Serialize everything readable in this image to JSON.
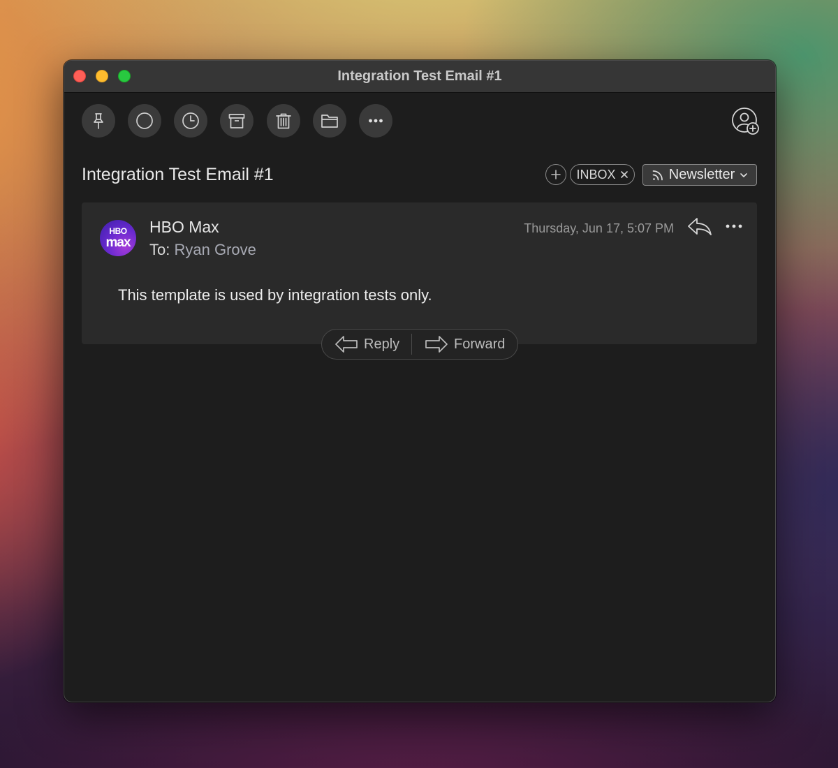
{
  "window": {
    "title": "Integration Test Email #1"
  },
  "toolbar": {
    "buttons": [
      {
        "icon": "pin-icon"
      },
      {
        "icon": "circle-icon"
      },
      {
        "icon": "clock-icon"
      },
      {
        "icon": "archive-icon"
      },
      {
        "icon": "trash-icon"
      },
      {
        "icon": "folder-icon"
      },
      {
        "icon": "more-icon"
      }
    ],
    "account_icon": "add-account-icon"
  },
  "header": {
    "subject": "Integration Test Email #1",
    "label": "INBOX",
    "category": "Newsletter"
  },
  "message": {
    "avatar_line1": "HBO",
    "avatar_line2": "max",
    "sender": "HBO Max",
    "to_prefix": "To:",
    "to_name": "Ryan Grove",
    "date": "Thursday, Jun 17, 5:07 PM",
    "body": "This template is used by integration tests only."
  },
  "actions": {
    "reply_label": "Reply",
    "forward_label": "Forward"
  },
  "colors": {
    "window_bg": "#1d1d1d",
    "titlebar_bg": "#363636",
    "card_bg": "#2a2a2a",
    "traffic_close": "#fe5f57",
    "traffic_min": "#febc2e",
    "traffic_max": "#28c840",
    "avatar_purple": "#6a2ad0"
  }
}
